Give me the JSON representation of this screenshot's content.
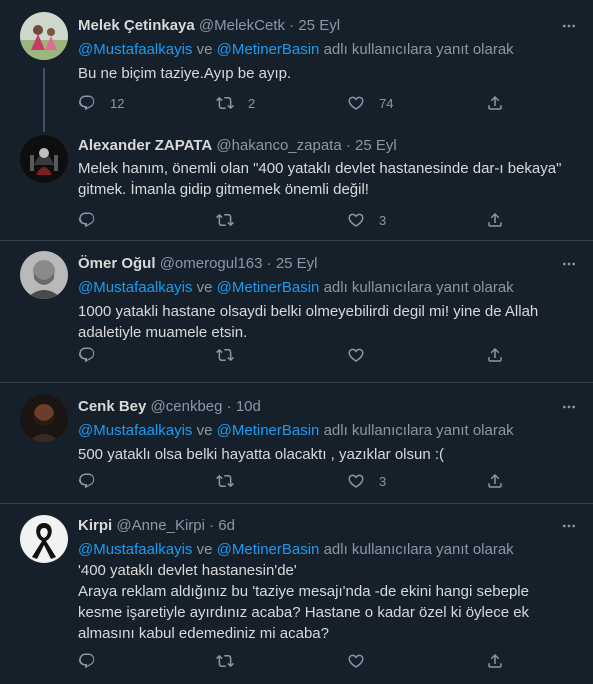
{
  "colors": {
    "background": "#15202b",
    "text": "#d9d9d9",
    "secondary": "#8899a6",
    "link": "#1d9bf0",
    "divider": "#38444d"
  },
  "tweets": [
    {
      "name": "Melek Çetinkaya",
      "handle": "@MelekCetk",
      "time": "25 Eyl",
      "reply_to": {
        "m1": "@Mustafaalkayis",
        "join": " ve ",
        "m2": "@MetinerBasin",
        "suffix": " adlı kullanıcılara yanıt olarak"
      },
      "text": "Bu ne biçim taziye.Ayıp be ayıp.",
      "replies": "12",
      "retweets": "2",
      "likes": "74"
    },
    {
      "name": "Alexander ZAPATA",
      "handle": "@hakanco_zapata",
      "time": "25 Eyl",
      "text": "Melek hanım, önemli olan \"400 yataklı devlet hastanesinde dar-ı bekaya\" gitmek. İmanla gidip gitmemek önemli değil!",
      "replies": "",
      "retweets": "",
      "likes": "3"
    },
    {
      "name": "Ömer Oğul",
      "handle": "@omerogul163",
      "time": "25 Eyl",
      "reply_to": {
        "m1": "@Mustafaalkayis",
        "join": " ve ",
        "m2": "@MetinerBasin",
        "suffix": " adlı kullanıcılara yanıt olarak"
      },
      "text": "1000 yatakli hastane olsaydi belki olmeyebilirdi degil mi! yine de Allah adaletiyle muamele etsin.",
      "replies": "",
      "retweets": "",
      "likes": ""
    },
    {
      "name": "Cenk Bey",
      "handle": "@cenkbeg",
      "time": "10d",
      "reply_to": {
        "m1": "@Mustafaalkayis",
        "join": " ve ",
        "m2": "@MetinerBasin",
        "suffix": " adlı kullanıcılara yanıt olarak"
      },
      "text": "500 yataklı olsa belki hayatta olacaktı , yazıklar olsun :(",
      "replies": "",
      "retweets": "",
      "likes": "3"
    },
    {
      "name": "Kirpi",
      "handle": "@Anne_Kirpi",
      "time": "6d",
      "reply_to": {
        "m1": "@Mustafaalkayis",
        "join": " ve ",
        "m2": "@MetinerBasin",
        "suffix": " adlı kullanıcılara yanıt olarak"
      },
      "text_line1": "'400 yataklı devlet hastanesin'de'",
      "text": "Araya reklam aldığınız bu 'taziye mesajı'nda -de ekini hangi sebeple kesme işaretiyle ayırdınız acaba? Hastane o kadar özel ki öylece ek almasını kabul edemediniz mi acaba?",
      "replies": "",
      "retweets": "",
      "likes": ""
    }
  ]
}
